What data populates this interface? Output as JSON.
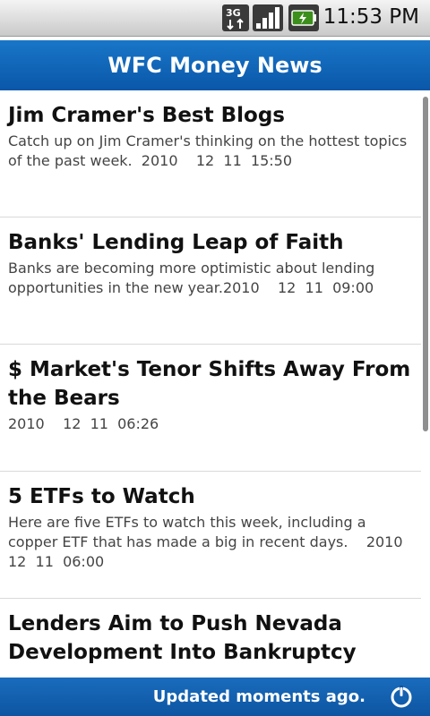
{
  "status_bar": {
    "network_label": "3G",
    "time": "11:53 PM"
  },
  "app": {
    "title": "WFC Money News"
  },
  "articles": [
    {
      "title": "Jim Cramer's Best Blogs",
      "body": "Catch up on Jim Cramer's thinking on the hottest topics of the past week.  2010    12  11  15:50"
    },
    {
      "title": "Banks' Lending Leap of Faith",
      "body": "Banks are becoming more optimistic about lending opportunities in the new year.2010    12  11  09:00"
    },
    {
      "title": "$ Market's Tenor Shifts Away From the Bears",
      "body": "2010    12  11  06:26"
    },
    {
      "title": "5 ETFs to Watch",
      "body": "Here are five ETFs to watch this week, including a copper ETF that has made a big in recent days.    2010    12  11  06:00"
    },
    {
      "title": "Lenders Aim to Push Nevada Development Into Bankruptcy",
      "body": ""
    }
  ],
  "footer": {
    "status_text": "Updated moments ago."
  },
  "colors": {
    "title_bar": "#0a57a9",
    "footer_bar": "#0d55a2"
  }
}
